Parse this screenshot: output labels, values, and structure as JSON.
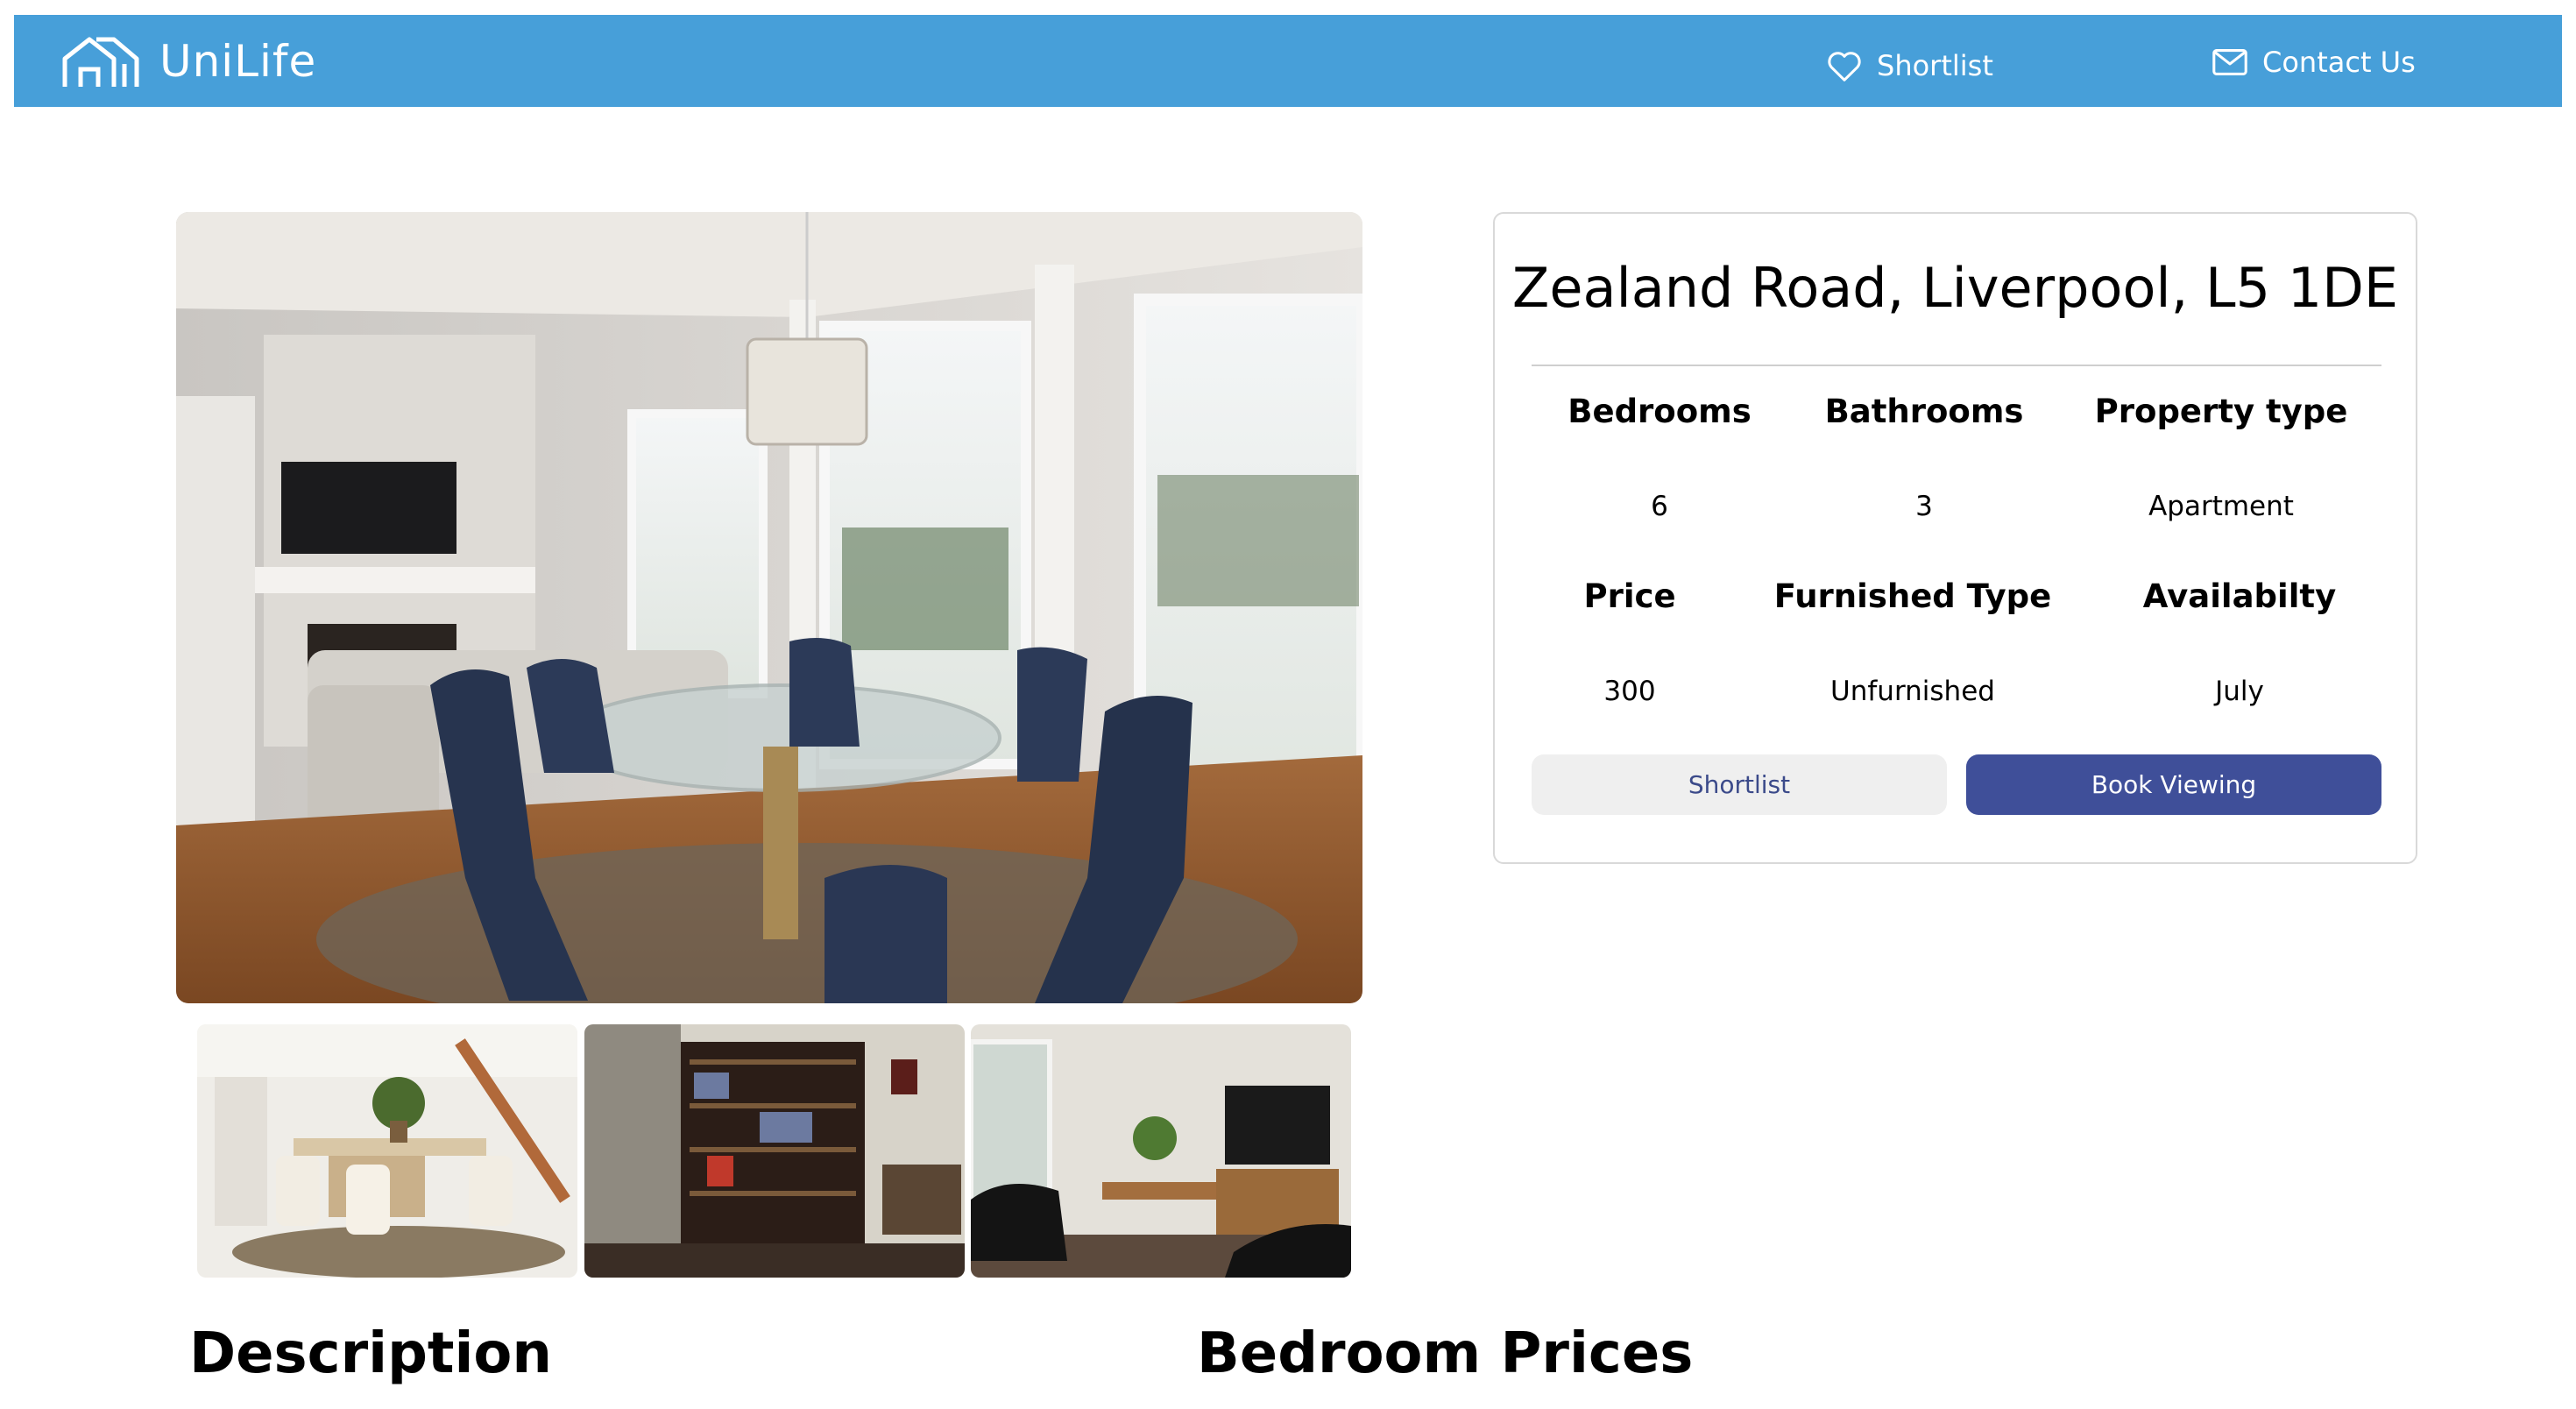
{
  "nav": {
    "brand": "UniLife",
    "shortlist_label": "Shortlist",
    "contact_label": "Contact Us"
  },
  "colors": {
    "nav_bg": "#479fd9",
    "book_button": "#3f4f99",
    "shortlist_button": "#efefef"
  },
  "property": {
    "address": "Zealand Road, Liverpool, L5 1DE",
    "specs": [
      {
        "label": "Bedrooms",
        "value": "6"
      },
      {
        "label": "Bathrooms",
        "value": "3"
      },
      {
        "label": "Property type",
        "value": "Apartment"
      },
      {
        "label": "Price",
        "value": "300"
      },
      {
        "label": "Furnished Type",
        "value": "Unfurnished"
      },
      {
        "label": "Availabilty",
        "value": "July"
      }
    ],
    "shortlist_button": "Shortlist",
    "book_button": "Book Viewing"
  },
  "sections": {
    "description": "Description",
    "bedroom_prices": "Bedroom Prices"
  },
  "icons": {
    "brand": "house-outline-icon",
    "shortlist": "heart-outline-icon",
    "contact": "envelope-outline-icon"
  }
}
